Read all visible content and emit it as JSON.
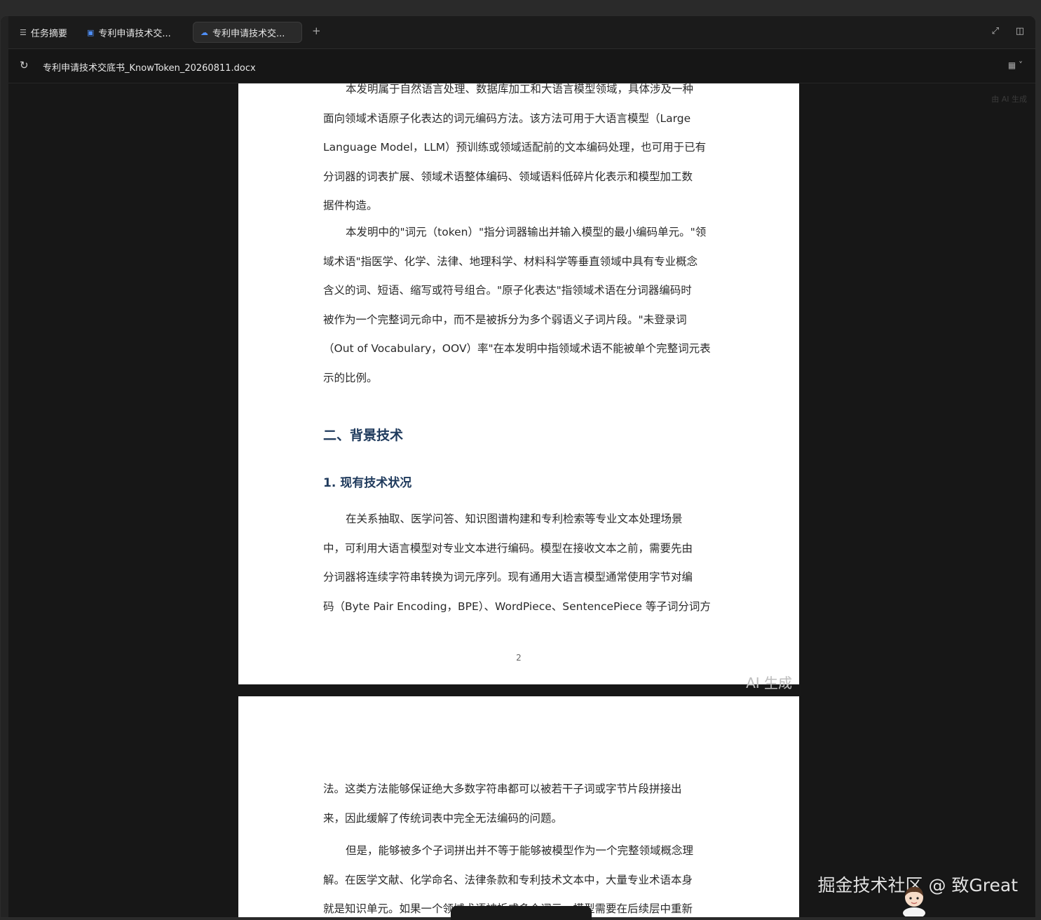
{
  "tabs": [
    {
      "label": "任务摘要",
      "icon": "list-icon"
    },
    {
      "label": "专利申请技术交...",
      "icon": "chat-bubble-icon"
    },
    {
      "label": "专利申请技术交...",
      "icon": "cloud-doc-icon",
      "active": true
    }
  ],
  "new_tab_label": "+",
  "address": {
    "filename": "专利申请技术交底书_KnowToken_20260811.docx"
  },
  "corner_mark": "由 AI 生成",
  "page1": {
    "para1_lines": [
      "本发明属于自然语言处理、数据库加工和大语言模型领域，具体涉及一种",
      "面向领域术语原子化表达的词元编码方法。该方法可用于大语言模型（Large",
      "Language Model，LLM）预训练或领域适配前的文本编码处理，也可用于已有",
      "分词器的词表扩展、领域术语整体编码、领域语料低碎片化表示和模型加工数",
      "据件构造。"
    ],
    "para2_lines": [
      "本发明中的\"词元（token）\"指分词器输出并输入模型的最小编码单元。\"领",
      "域术语\"指医学、化学、法律、地理科学、材料科学等垂直领域中具有专业概念",
      "含义的词、短语、缩写或符号组合。\"原子化表达\"指领域术语在分词器编码时",
      "被作为一个完整词元命中，而不是被拆分为多个弱语义子词片段。\"未登录词",
      "（Out of Vocabulary，OOV）率\"在本发明中指领域术语不能被单个完整词元表",
      "示的比例。"
    ],
    "heading_section": "二、背景技术",
    "heading_sub": "1. 现有技术状况",
    "para3_lines": [
      "在关系抽取、医学问答、知识图谱构建和专利检索等专业文本处理场景",
      "中，可利用大语言模型对专业文本进行编码。模型在接收文本之前，需要先由",
      "分词器将连续字符串转换为词元序列。现有通用大语言模型通常使用字节对编",
      "码（Byte Pair Encoding，BPE）、WordPiece、SentencePiece 等子词分词方"
    ],
    "page_number": "2",
    "ai_mark": "AI 生成"
  },
  "page2": {
    "para1_lines": [
      "法。这类方法能够保证绝大多数字符串都可以被若干子词或字节片段拼接出",
      "来，因此缓解了传统词表中完全无法编码的问题。"
    ],
    "para2_lines": [
      "但是，能够被多个子词拼出并不等于能够被模型作为一个完整领域概念理",
      "解。在医学文献、化学命名、法律条款和专利技术文本中，大量专业术语本身",
      "就是知识单元。如果一个领域术语被拆成多个词元，模型需要在后续层中重新"
    ]
  },
  "watermark": "掘金技术社区 @ 致Great"
}
